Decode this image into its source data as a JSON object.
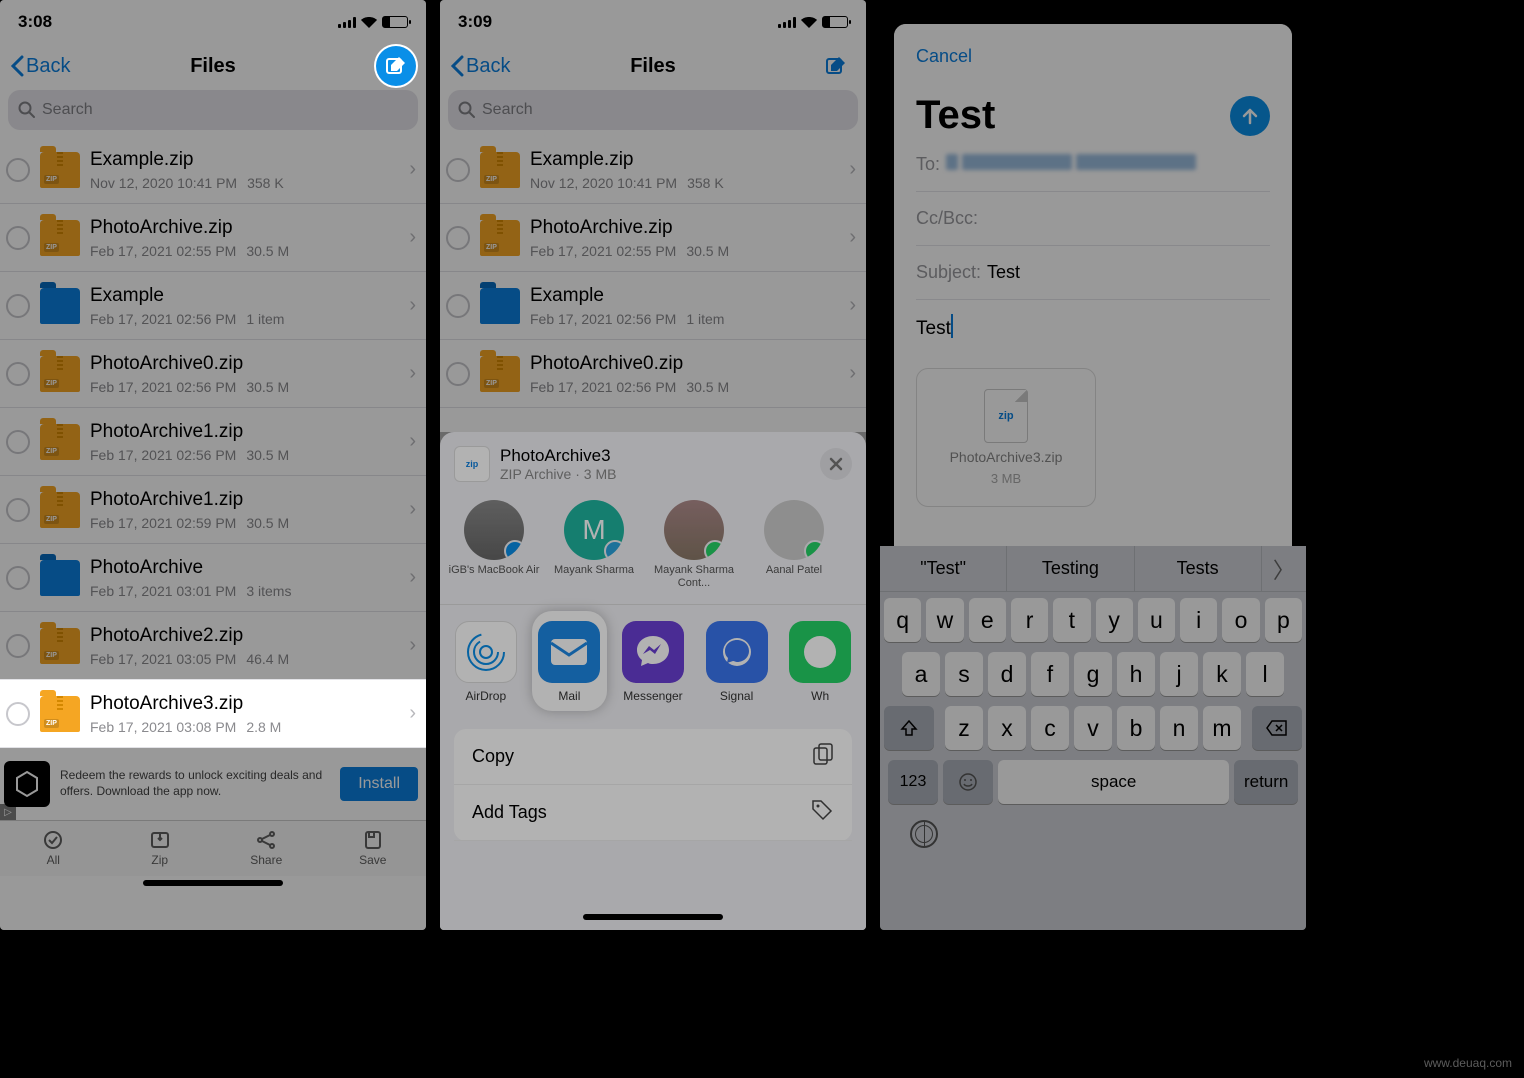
{
  "panel1": {
    "status_time": "3:08",
    "nav_back": "Back",
    "nav_title": "Files",
    "search_placeholder": "Search",
    "files": [
      {
        "name": "Example.zip",
        "date": "Nov 12, 2020 10:41 PM",
        "size": "358 K",
        "type": "zip"
      },
      {
        "name": "PhotoArchive.zip",
        "date": "Feb 17, 2021 02:55 PM",
        "size": "30.5 M",
        "type": "zip"
      },
      {
        "name": "Example",
        "date": "Feb 17, 2021 02:56 PM",
        "size": "1 item",
        "type": "folder"
      },
      {
        "name": "PhotoArchive0.zip",
        "date": "Feb 17, 2021 02:56 PM",
        "size": "30.5 M",
        "type": "zip"
      },
      {
        "name": "PhotoArchive1.zip",
        "date": "Feb 17, 2021 02:56 PM",
        "size": "30.5 M",
        "type": "zip"
      },
      {
        "name": "PhotoArchive1.zip",
        "date": "Feb 17, 2021 02:59 PM",
        "size": "30.5 M",
        "type": "zip"
      },
      {
        "name": "PhotoArchive",
        "date": "Feb 17, 2021 03:01 PM",
        "size": "3 items",
        "type": "folder"
      },
      {
        "name": "PhotoArchive2.zip",
        "date": "Feb 17, 2021 03:05 PM",
        "size": "46.4 M",
        "type": "zip"
      },
      {
        "name": "PhotoArchive3.zip",
        "date": "Feb 17, 2021 03:08 PM",
        "size": "2.8 M",
        "type": "zip"
      }
    ],
    "ad_text": "Redeem the rewards to unlock exciting deals and offers. Download the app now.",
    "ad_button": "Install",
    "tabs": [
      {
        "label": "All"
      },
      {
        "label": "Zip"
      },
      {
        "label": "Share"
      },
      {
        "label": "Save"
      }
    ]
  },
  "panel2": {
    "status_time": "3:09",
    "nav_back": "Back",
    "nav_title": "Files",
    "search_placeholder": "Search",
    "files": [
      {
        "name": "Example.zip",
        "date": "Nov 12, 2020 10:41 PM",
        "size": "358 K",
        "type": "zip"
      },
      {
        "name": "PhotoArchive.zip",
        "date": "Feb 17, 2021 02:55 PM",
        "size": "30.5 M",
        "type": "zip"
      },
      {
        "name": "Example",
        "date": "Feb 17, 2021 02:56 PM",
        "size": "1 item",
        "type": "folder"
      },
      {
        "name": "PhotoArchive0.zip",
        "date": "Feb 17, 2021 02:56 PM",
        "size": "30.5 M",
        "type": "zip"
      }
    ],
    "share": {
      "title": "PhotoArchive3",
      "subtitle": "ZIP Archive · 3 MB",
      "contacts": [
        {
          "name": "iGB's MacBook Air",
          "badge": "airdrop"
        },
        {
          "name": "Mayank Sharma",
          "badge": "telegram"
        },
        {
          "name": "Mayank Sharma Cont...",
          "badge": "whatsapp"
        },
        {
          "name": "Aanal Patel",
          "badge": "whatsapp"
        }
      ],
      "apps": [
        {
          "name": "AirDrop",
          "color": "#fff"
        },
        {
          "name": "Mail",
          "color": "#1e88e5"
        },
        {
          "name": "Messenger",
          "color": "#6b3fd4"
        },
        {
          "name": "Signal",
          "color": "#3a76f0"
        },
        {
          "name": "Wh",
          "color": "#25d366"
        }
      ],
      "actions": [
        {
          "label": "Copy",
          "icon": "copy"
        },
        {
          "label": "Add Tags",
          "icon": "tag"
        }
      ]
    }
  },
  "panel3": {
    "cancel": "Cancel",
    "title": "Test",
    "to_label": "To:",
    "ccbcc_label": "Cc/Bcc:",
    "subject_label": "Subject:",
    "subject_value": "Test",
    "body": "Test",
    "attachment": {
      "name": "PhotoArchive3.zip",
      "size": "3 MB",
      "thumb": "zip"
    },
    "suggestions": [
      "\"Test\"",
      "Testing",
      "Tests"
    ],
    "keyboard": {
      "row1": [
        "q",
        "w",
        "e",
        "r",
        "t",
        "y",
        "u",
        "i",
        "o",
        "p"
      ],
      "row2": [
        "a",
        "s",
        "d",
        "f",
        "g",
        "h",
        "j",
        "k",
        "l"
      ],
      "row3": [
        "z",
        "x",
        "c",
        "v",
        "b",
        "n",
        "m"
      ],
      "numkey": "123",
      "space": "space",
      "return": "return"
    }
  },
  "watermark": "www.deuaq.com"
}
